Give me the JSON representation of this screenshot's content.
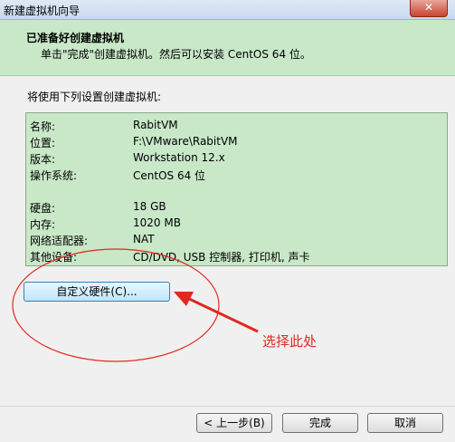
{
  "window": {
    "title": "新建虚拟机向导",
    "close_label": "✕"
  },
  "header": {
    "title": "已准备好创建虚拟机",
    "subtitle": "单击\"完成\"创建虚拟机。然后可以安装 CentOS 64 位。"
  },
  "intro": "将使用下列设置创建虚拟机:",
  "settings": [
    {
      "label": "名称:",
      "value": "RabitVM"
    },
    {
      "label": "位置:",
      "value": "F:\\VMware\\RabitVM"
    },
    {
      "label": "版本:",
      "value": "Workstation 12.x"
    },
    {
      "label": "操作系统:",
      "value": "CentOS 64 位"
    },
    {
      "label": "硬盘:",
      "value": "18 GB"
    },
    {
      "label": "内存:",
      "value": "1020 MB"
    },
    {
      "label": "网络适配器:",
      "value": "NAT"
    },
    {
      "label": "其他设备:",
      "value": "CD/DVD, USB 控制器, 打印机, 声卡"
    }
  ],
  "buttons": {
    "customize": "自定义硬件(C)...",
    "back": "< 上一步(B)",
    "finish": "完成",
    "cancel": "取消"
  },
  "annotation": {
    "text": "选择此处",
    "color": "#e0281e"
  },
  "colors": {
    "header_bg": "#c8e8c8",
    "info_bg": "#c8e8c8"
  }
}
